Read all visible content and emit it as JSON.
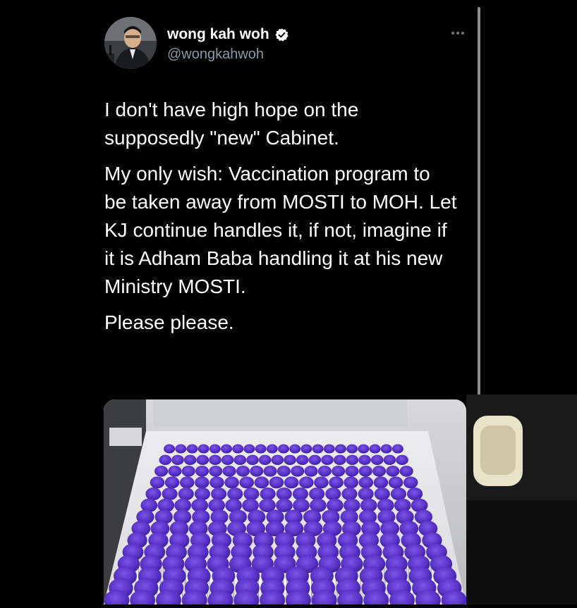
{
  "tweet": {
    "author": {
      "display_name": "wong kah woh",
      "handle": "@wongkahwoh",
      "verified": true,
      "avatar_icon": "user-avatar",
      "verified_icon": "verified-badge-icon"
    },
    "more_icon": "more-options-icon",
    "paragraphs": [
      "I don't have high hope on the supposedly \"new\" Cabinet.",
      "My only wish: Vaccination program to be taken away from MOSTI to MOH. Let KJ continue handles it, if not, imagine if it is Adham Baba handling it at his new Ministry MOSTI.",
      "Please please."
    ],
    "media": {
      "kind": "photo",
      "subject": "vaccine-vials-tray"
    }
  },
  "colors": {
    "background": "#000000",
    "text_primary": "#ffffff",
    "text_secondary": "#8b98a5",
    "verified_badge": "#ffffff",
    "vial_cap": "#5b35c9",
    "scrollbar": "#8a8d91"
  }
}
